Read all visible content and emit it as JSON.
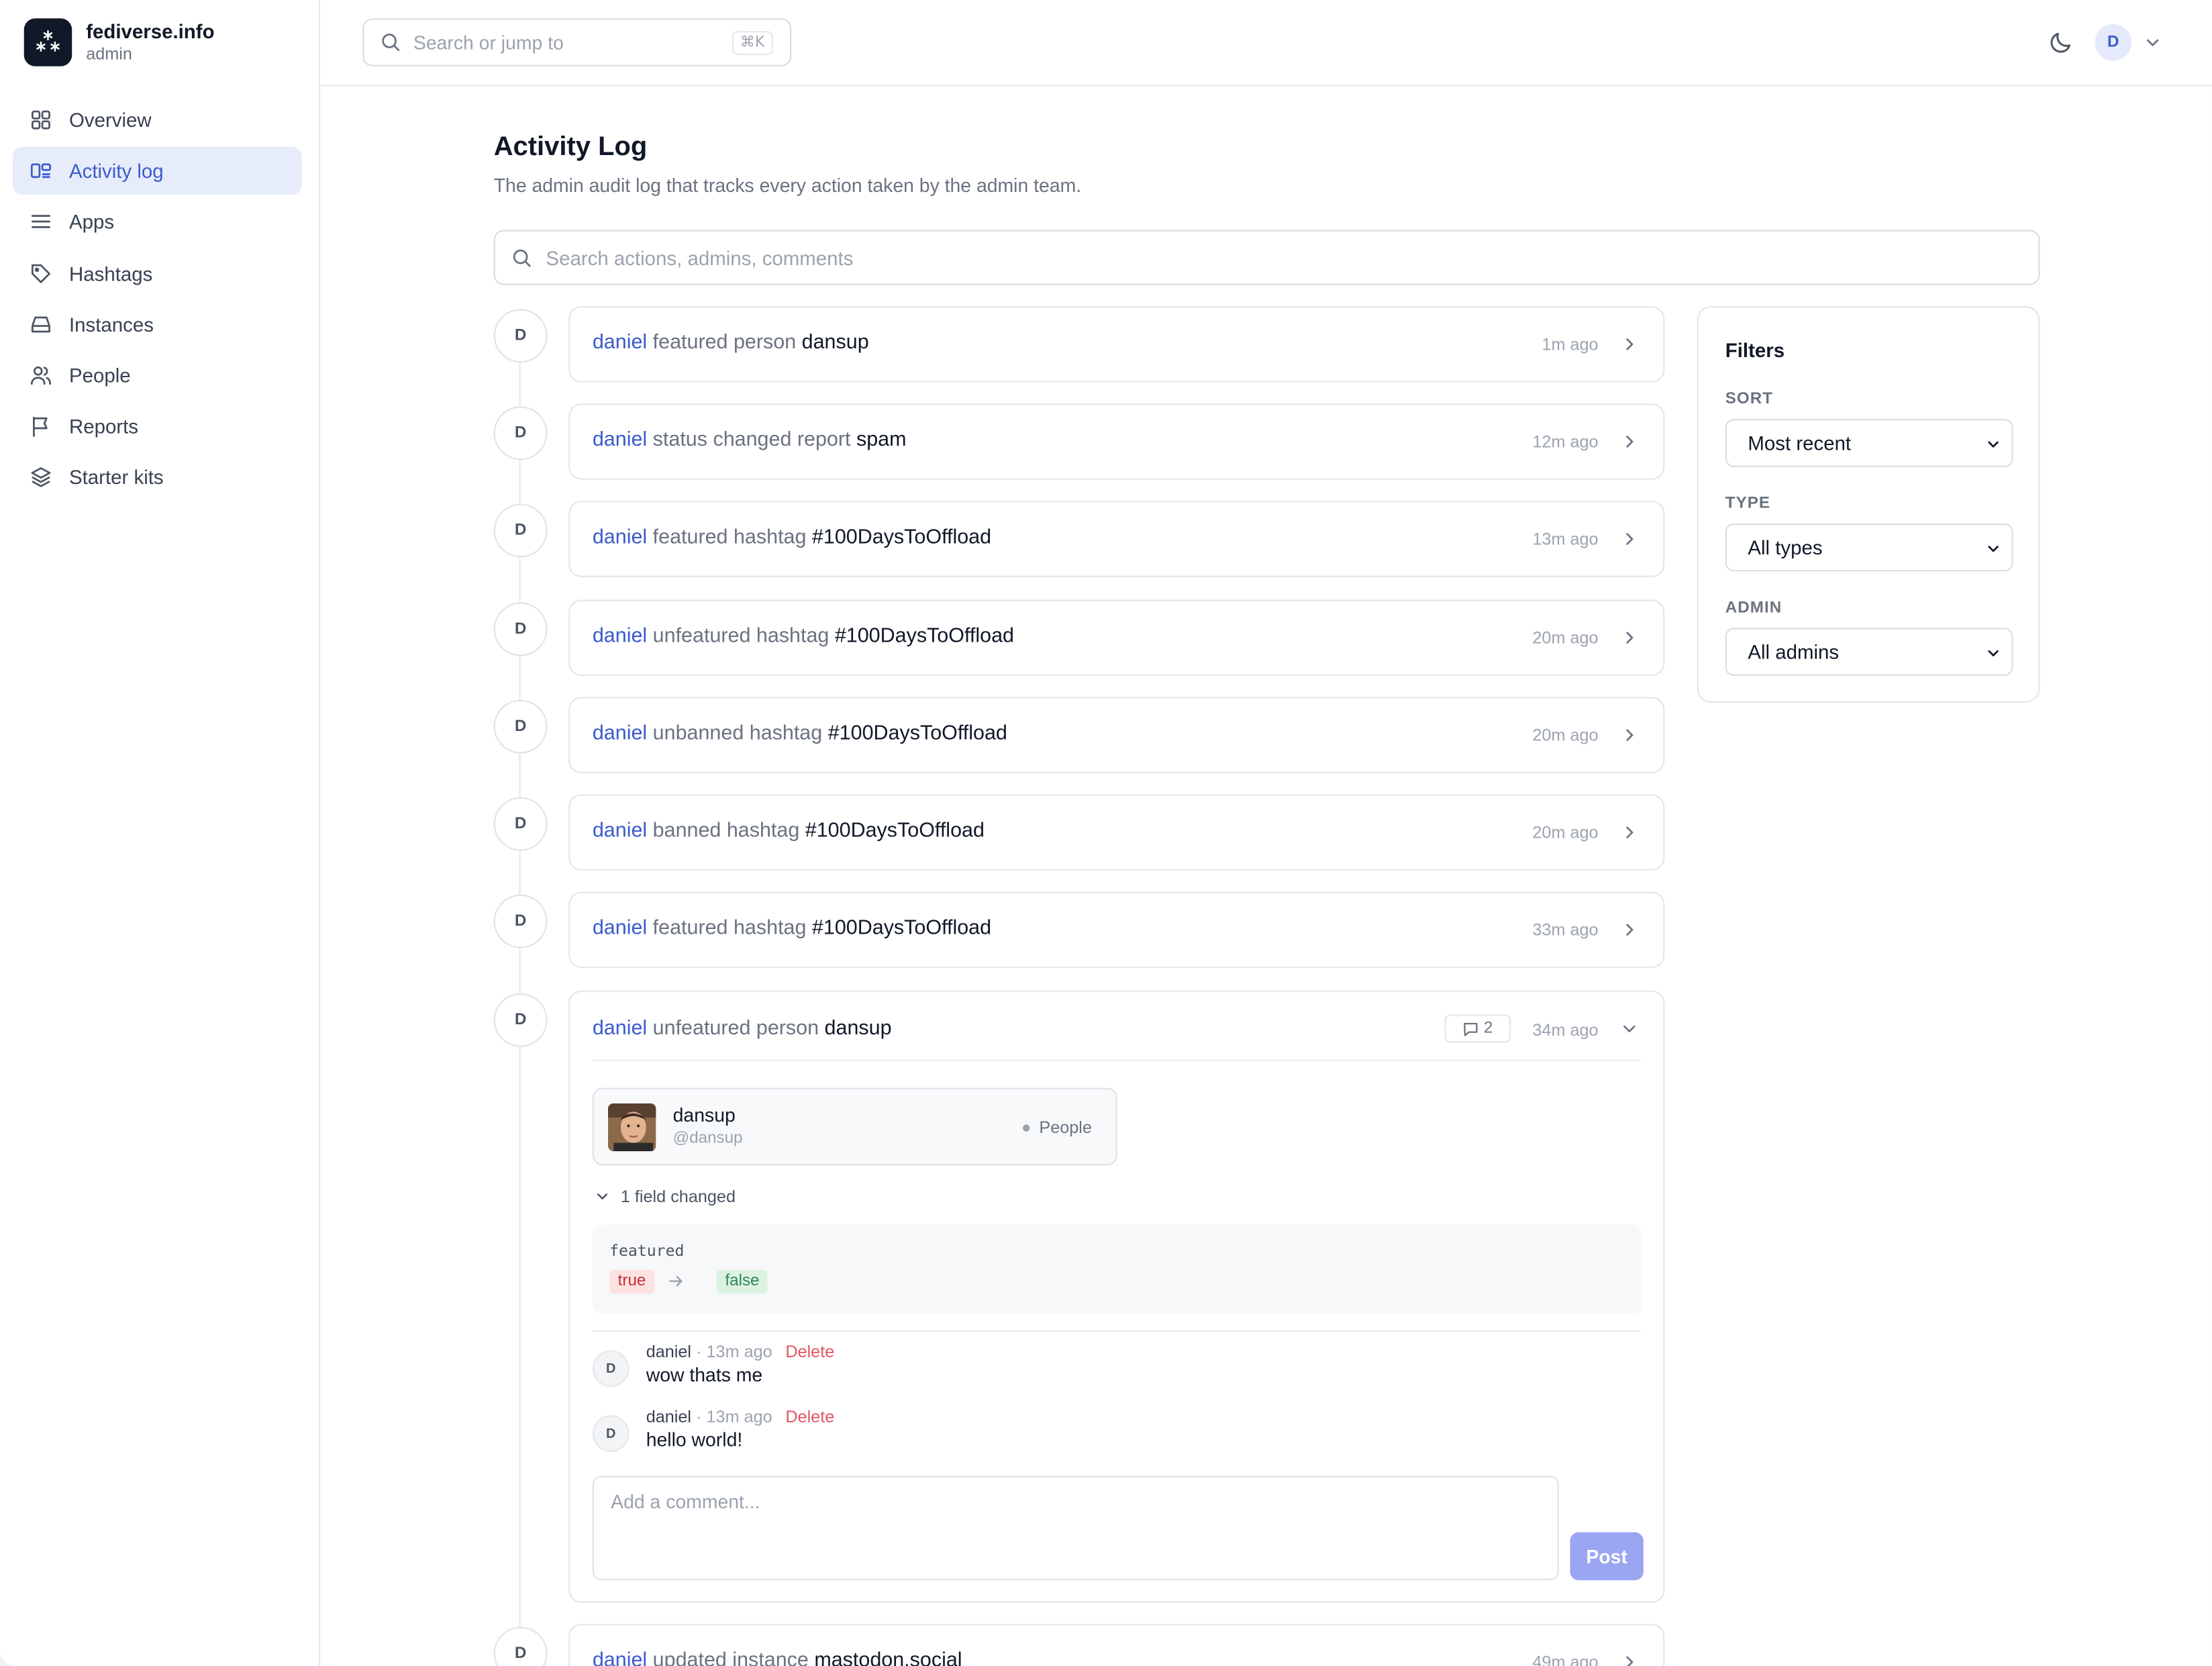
{
  "brand": {
    "name": "fediverse.info",
    "role": "admin"
  },
  "sidebar": {
    "items": [
      {
        "label": "Overview",
        "icon": "grid-icon",
        "active": false
      },
      {
        "label": "Activity log",
        "icon": "activity-icon",
        "active": true
      },
      {
        "label": "Apps",
        "icon": "menu-icon",
        "active": false
      },
      {
        "label": "Hashtags",
        "icon": "tag-icon",
        "active": false
      },
      {
        "label": "Instances",
        "icon": "server-icon",
        "active": false
      },
      {
        "label": "People",
        "icon": "users-icon",
        "active": false
      },
      {
        "label": "Reports",
        "icon": "flag-icon",
        "active": false
      },
      {
        "label": "Starter kits",
        "icon": "layers-icon",
        "active": false
      }
    ]
  },
  "topbar": {
    "search_placeholder": "Search or jump to",
    "shortcut": "⌘K",
    "user_initial": "D"
  },
  "page": {
    "title": "Activity Log",
    "subtitle": "The admin audit log that tracks every action taken by the admin team.",
    "search_placeholder": "Search actions, admins, comments"
  },
  "entries": [
    {
      "initial": "D",
      "actor": "daniel",
      "action": "featured person",
      "target": "dansup",
      "time": "1m ago"
    },
    {
      "initial": "D",
      "actor": "daniel",
      "action": "status changed report",
      "target": "spam",
      "time": "12m ago"
    },
    {
      "initial": "D",
      "actor": "daniel",
      "action": "featured hashtag",
      "target": "#100DaysToOffload",
      "time": "13m ago"
    },
    {
      "initial": "D",
      "actor": "daniel",
      "action": "unfeatured hashtag",
      "target": "#100DaysToOffload",
      "time": "20m ago"
    },
    {
      "initial": "D",
      "actor": "daniel",
      "action": "unbanned hashtag",
      "target": "#100DaysToOffload",
      "time": "20m ago"
    },
    {
      "initial": "D",
      "actor": "daniel",
      "action": "banned hashtag",
      "target": "#100DaysToOffload",
      "time": "20m ago"
    },
    {
      "initial": "D",
      "actor": "daniel",
      "action": "featured hashtag",
      "target": "#100DaysToOffload",
      "time": "33m ago"
    }
  ],
  "expanded": {
    "initial": "D",
    "actor": "daniel",
    "action": "unfeatured person",
    "target": "dansup",
    "time": "34m ago",
    "comment_count": "2",
    "person": {
      "name": "dansup",
      "handle": "@dansup",
      "type": "People"
    },
    "fields_changed": "1 field changed",
    "diff": {
      "key": "featured",
      "old": "true",
      "new": "false"
    },
    "comments": [
      {
        "initial": "D",
        "author": "daniel",
        "separator": "·",
        "time": "13m ago",
        "delete": "Delete",
        "body": "wow thats me"
      },
      {
        "initial": "D",
        "author": "daniel",
        "separator": "·",
        "time": "13m ago",
        "delete": "Delete",
        "body": "hello world!"
      }
    ],
    "comment_placeholder": "Add a comment...",
    "post_label": "Post"
  },
  "last_entry": {
    "initial": "D",
    "actor": "daniel",
    "action": "updated instance",
    "target": "mastodon.social",
    "time": "49m ago"
  },
  "filters": {
    "title": "Filters",
    "sort": {
      "label": "SORT",
      "value": "Most recent"
    },
    "type": {
      "label": "TYPE",
      "value": "All types"
    },
    "admin": {
      "label": "ADMIN",
      "value": "All admins"
    }
  },
  "colors": {
    "accent": "#3b5bcc",
    "active_bg": "#e7ecfb",
    "delete": "#e25563",
    "post_button": "#9aa6f2"
  }
}
